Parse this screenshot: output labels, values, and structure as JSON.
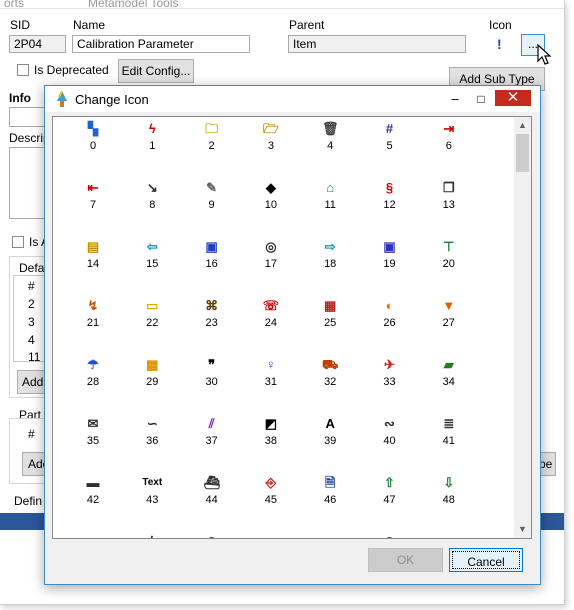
{
  "background_window": {
    "top_labels": [
      "orts",
      "Metamodel Tools"
    ],
    "sid_label": "SID",
    "sid_value": "2P04",
    "name_label": "Name",
    "name_value": "Calibration Parameter",
    "parent_label": "Parent",
    "parent_value": "Item",
    "icon_label": "Icon",
    "browse_button": "...",
    "is_deprecated_label": "Is Deprecated",
    "edit_config_button": "Edit Config...",
    "add_sub_type_button": "Add Sub Type",
    "info_label": "Info",
    "description_label": "Descrip",
    "is_label": "Is A",
    "defaults_label": "Defa",
    "grid_header": "#",
    "grid_rows": [
      "2",
      "3",
      "4",
      "11"
    ],
    "add_button": "Add",
    "part_label": "Part T",
    "part_grid_header": "#",
    "add_button_2": "Add",
    "right_button_fragment": "pe",
    "definition_label": "Defin"
  },
  "dialog": {
    "title": "Change Icon",
    "minimize": "‒",
    "maximize": "□",
    "close": "✕",
    "ok_label": "OK",
    "cancel_label": "Cancel",
    "icons": [
      {
        "n": "0",
        "glyph": "▚",
        "color": "#2060d0",
        "name": "color-blocks-icon"
      },
      {
        "n": "1",
        "glyph": "ϟ",
        "color": "#d00000",
        "name": "lightning-icon"
      },
      {
        "n": "2",
        "glyph": "🗀",
        "color": "#d4a000",
        "name": "folder-icon"
      },
      {
        "n": "3",
        "glyph": "🗁",
        "color": "#c09000",
        "name": "open-folder-icon"
      },
      {
        "n": "4",
        "glyph": "🗑",
        "color": "#404040",
        "name": "trash-icon"
      },
      {
        "n": "5",
        "glyph": "#",
        "color": "#303090",
        "name": "hash-icon"
      },
      {
        "n": "6",
        "glyph": "⇥",
        "color": "#d00000",
        "name": "arrow-right-bar-icon"
      },
      {
        "n": "7",
        "glyph": "⇤",
        "color": "#d00000",
        "name": "arrow-left-bar-icon"
      },
      {
        "n": "8",
        "glyph": "↘",
        "color": "#303030",
        "name": "arrow-diagonal-icon"
      },
      {
        "n": "9",
        "glyph": "✎",
        "color": "#606060",
        "name": "pen-icon"
      },
      {
        "n": "10",
        "glyph": "◆",
        "color": "#000000",
        "name": "tag-icon"
      },
      {
        "n": "11",
        "glyph": "⌂",
        "color": "#208040",
        "name": "house-icon"
      },
      {
        "n": "12",
        "glyph": "§",
        "color": "#d00000",
        "name": "section-icon"
      },
      {
        "n": "13",
        "glyph": "❐",
        "color": "#303030",
        "name": "copy-icon"
      },
      {
        "n": "14",
        "glyph": "▤",
        "color": "#c09000",
        "name": "folder-grid-icon"
      },
      {
        "n": "15",
        "glyph": "⇦",
        "color": "#00a0b0",
        "name": "arrow-left-icon"
      },
      {
        "n": "16",
        "glyph": "▣",
        "color": "#2040c0",
        "name": "floppy-icon"
      },
      {
        "n": "17",
        "glyph": "◎",
        "color": "#303030",
        "name": "target-icon"
      },
      {
        "n": "18",
        "glyph": "⇨",
        "color": "#00a0b0",
        "name": "arrow-right-icon"
      },
      {
        "n": "19",
        "glyph": "▣",
        "color": "#3030c0",
        "name": "disk-icon"
      },
      {
        "n": "20",
        "glyph": "⊤",
        "color": "#208040",
        "name": "hierarchy-icon"
      },
      {
        "n": "21",
        "glyph": "↯",
        "color": "#c05000",
        "name": "zigzag-icon"
      },
      {
        "n": "22",
        "glyph": "▭",
        "color": "#e0b000",
        "name": "note-icon"
      },
      {
        "n": "23",
        "glyph": "⌘",
        "color": "#604000",
        "name": "cmd-icon"
      },
      {
        "n": "24",
        "glyph": "☏",
        "color": "#d00000",
        "name": "phone-icon"
      },
      {
        "n": "25",
        "glyph": "▦",
        "color": "#c02020",
        "name": "grid-icon"
      },
      {
        "n": "26",
        "glyph": "◐",
        "color": "#e07000",
        "name": "half-circle-icon"
      },
      {
        "n": "27",
        "glyph": "▼",
        "color": "#e06000",
        "name": "download-icon"
      },
      {
        "n": "28",
        "glyph": "☂",
        "color": "#2050d0",
        "name": "umbrella-icon"
      },
      {
        "n": "29",
        "glyph": "▩",
        "color": "#e09000",
        "name": "box-icon"
      },
      {
        "n": "30",
        "glyph": "❞",
        "color": "#000000",
        "name": "quote-icon"
      },
      {
        "n": "31",
        "glyph": "♀",
        "color": "#2050d0",
        "name": "person-icon"
      },
      {
        "n": "32",
        "glyph": "⛟",
        "color": "#c04000",
        "name": "truck-icon"
      },
      {
        "n": "33",
        "glyph": "✈",
        "color": "#d02020",
        "name": "plane-icon"
      },
      {
        "n": "34",
        "glyph": "▰",
        "color": "#208020",
        "name": "block-icon"
      },
      {
        "n": "35",
        "glyph": "✉",
        "color": "#303030",
        "name": "mail-icon"
      },
      {
        "n": "36",
        "glyph": "∽",
        "color": "#303030",
        "name": "wave-icon"
      },
      {
        "n": "37",
        "glyph": "⫽",
        "color": "#8020c0",
        "name": "slashes-icon"
      },
      {
        "n": "38",
        "glyph": "◩",
        "color": "#000000",
        "name": "image-icon"
      },
      {
        "n": "39",
        "glyph": "A",
        "color": "#000000",
        "name": "letter-a-icon"
      },
      {
        "n": "40",
        "glyph": "∾",
        "color": "#303030",
        "name": "curve-icon"
      },
      {
        "n": "41",
        "glyph": "≣",
        "color": "#303030",
        "name": "text-lines-icon"
      },
      {
        "n": "42",
        "glyph": "▬",
        "color": "#303030",
        "name": "bar-icon"
      },
      {
        "n": "43",
        "glyph": "Text",
        "color": "#000000",
        "name": "text-icon"
      },
      {
        "n": "44",
        "glyph": "⛴",
        "color": "#303030",
        "name": "ship-icon"
      },
      {
        "n": "45",
        "glyph": "⎆",
        "color": "#c02020",
        "name": "enter-icon"
      },
      {
        "n": "46",
        "glyph": "🗎",
        "color": "#2040a0",
        "name": "document-icon"
      },
      {
        "n": "47",
        "glyph": "⇧",
        "color": "#208040",
        "name": "arrow-up-icon"
      },
      {
        "n": "48",
        "glyph": "⇩",
        "color": "#208040",
        "name": "arrow-down-icon"
      },
      {
        "n": "",
        "glyph": "➙",
        "color": "#d00000",
        "name": "partial-arrow-icon"
      },
      {
        "n": "",
        "glyph": "⌇",
        "color": "#303030",
        "name": "partial-icon"
      },
      {
        "n": "",
        "glyph": "?",
        "color": "#2040c0",
        "name": "partial-question-icon"
      },
      {
        "n": "",
        "glyph": "ı",
        "color": "#2040c0",
        "name": "partial-figure-icon"
      },
      {
        "n": "",
        "glyph": "◘",
        "color": "#303030",
        "name": "partial-box-icon"
      },
      {
        "n": "",
        "glyph": "§",
        "color": "#208040",
        "name": "partial-section-icon"
      },
      {
        "n": "",
        "glyph": "▭",
        "color": "#303030",
        "name": "partial-frame-icon"
      }
    ]
  }
}
